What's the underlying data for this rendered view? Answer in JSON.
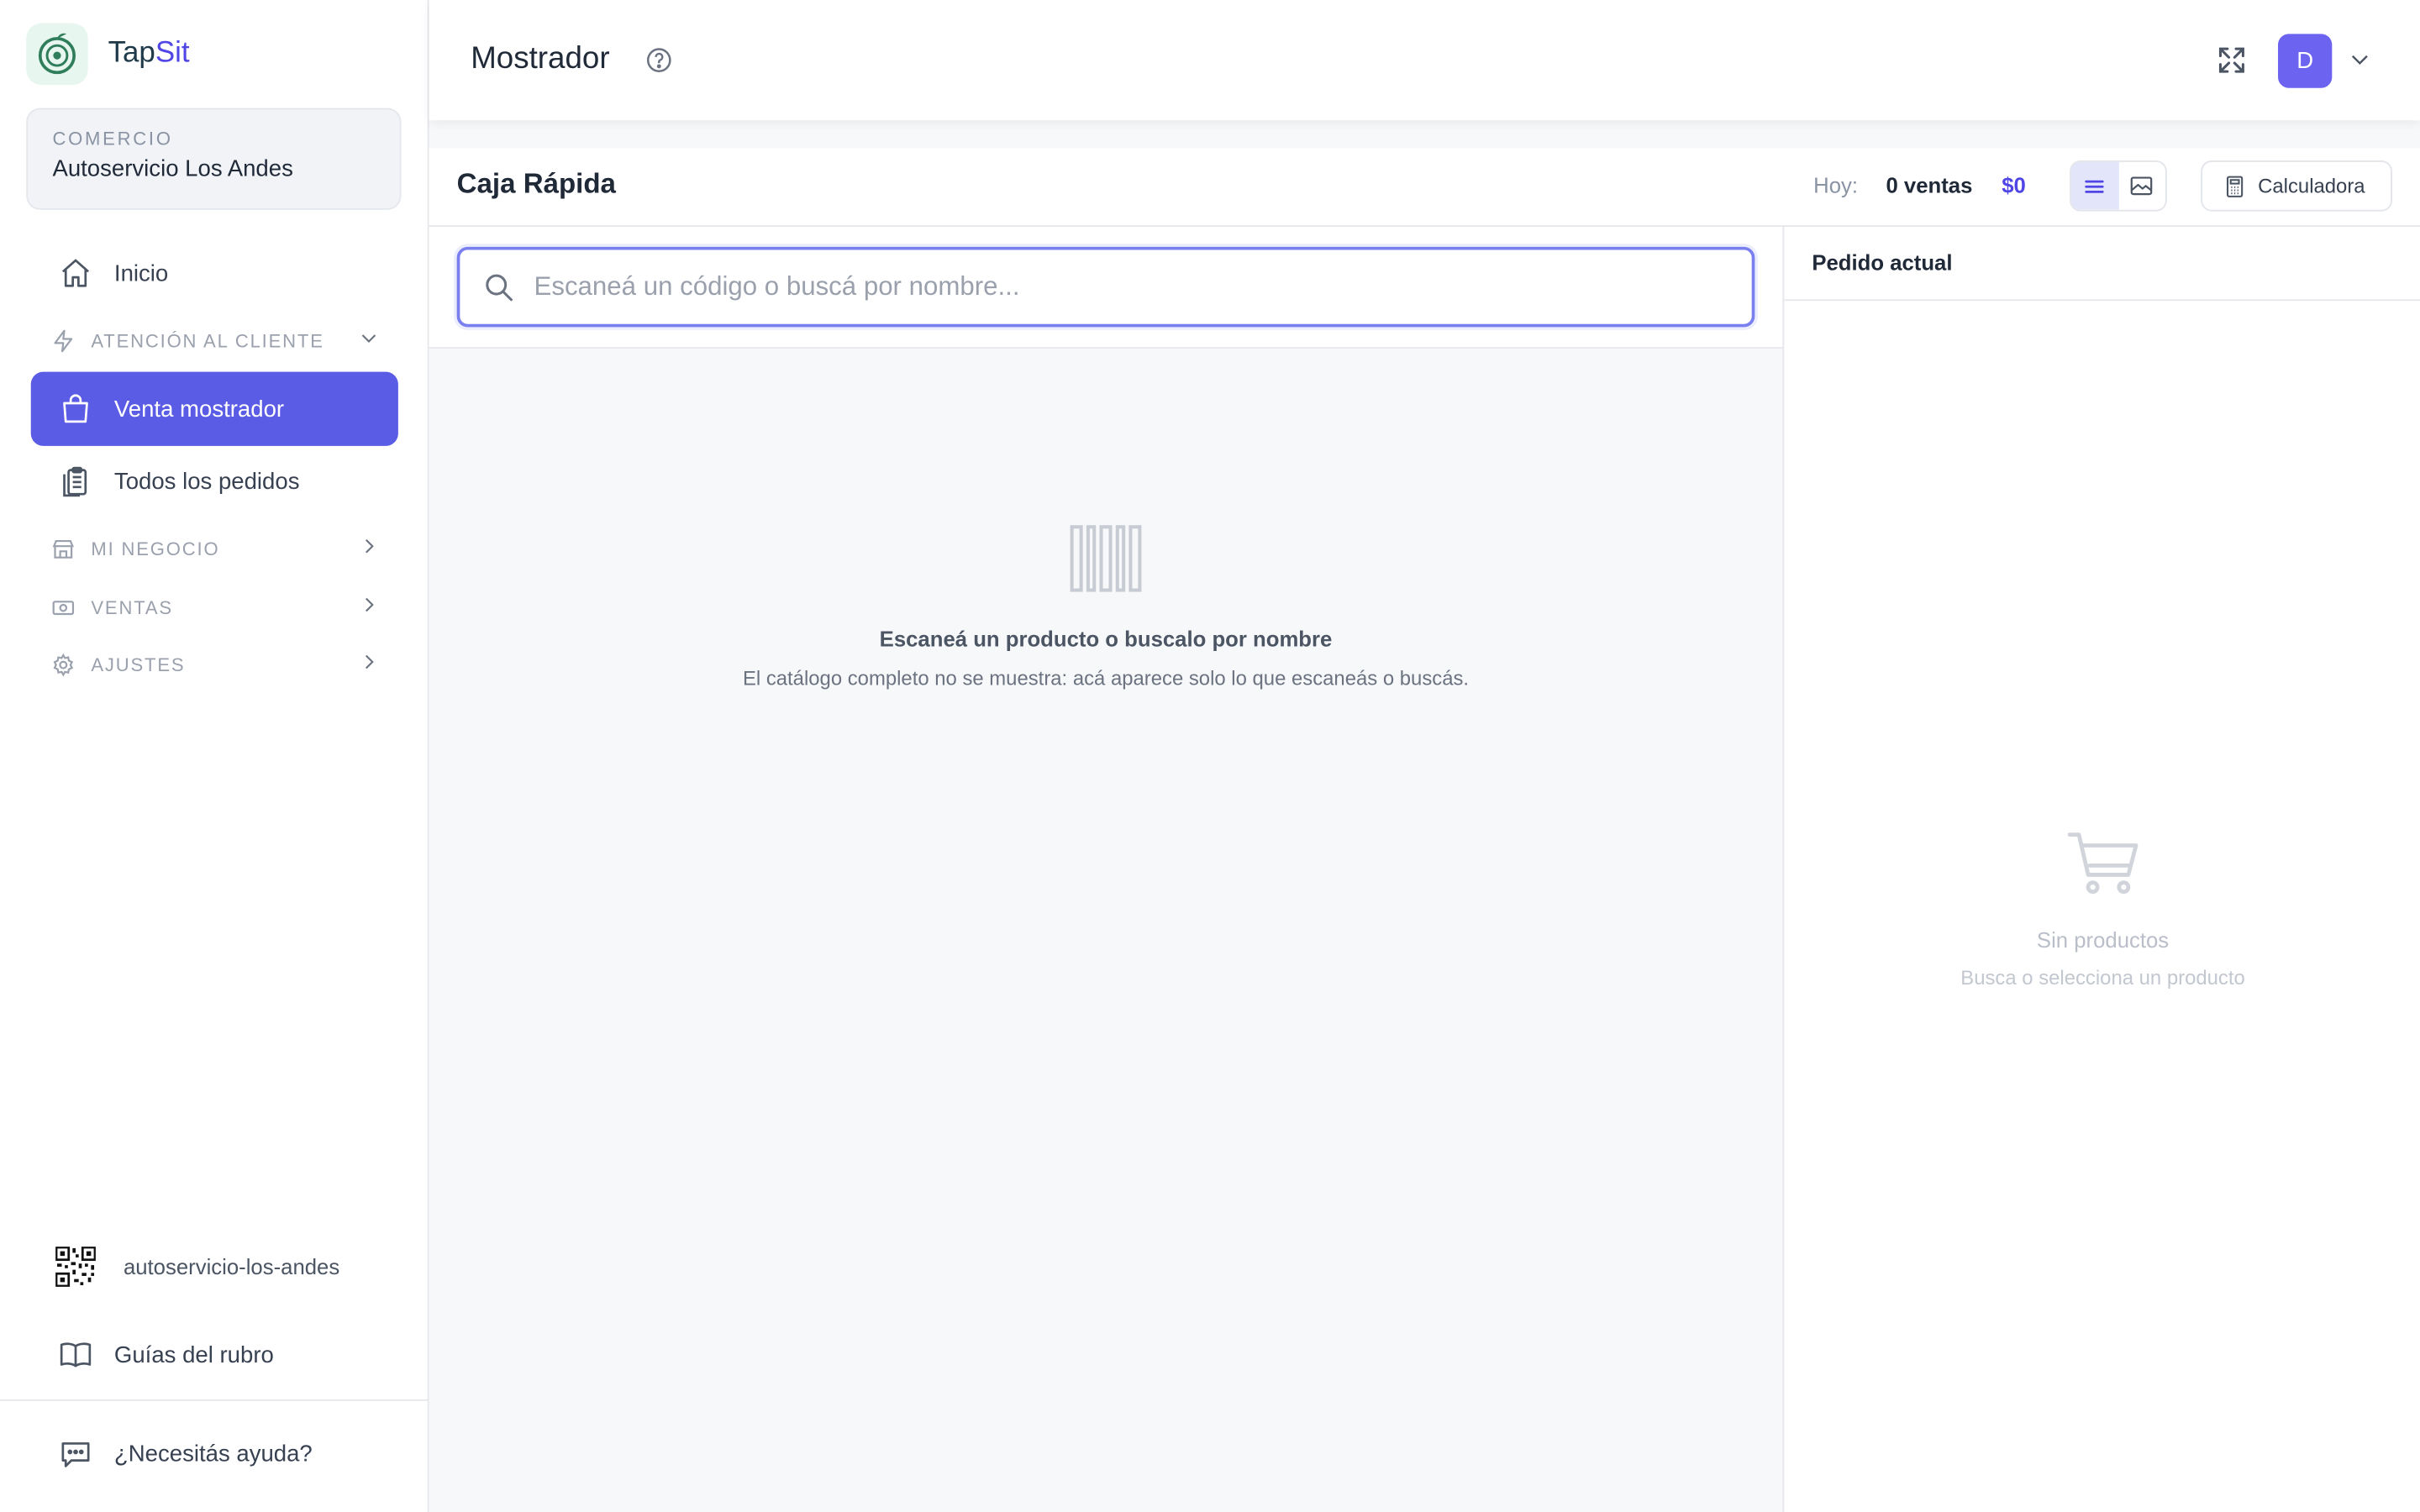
{
  "brand": {
    "name_part1": "Tap",
    "name_part2": "Sit",
    "logo_icon": "logo-icon",
    "accent_color": "#4f46e5"
  },
  "store": {
    "label": "COMERCIO",
    "name": "Autoservicio Los Andes"
  },
  "sidebar": {
    "items": [
      {
        "label": "Inicio",
        "icon": "home-icon"
      },
      {
        "label": "ATENCIÓN AL CLIENTE",
        "icon": "bolt-icon",
        "type": "section",
        "expanded": true
      },
      {
        "label": "Venta mostrador",
        "icon": "shopping-bag-icon",
        "active": true
      },
      {
        "label": "Todos los pedidos",
        "icon": "clipboard-icon"
      },
      {
        "label": "MI NEGOCIO",
        "icon": "store-icon",
        "type": "section"
      },
      {
        "label": "VENTAS",
        "icon": "cash-icon",
        "type": "section"
      },
      {
        "label": "AJUSTES",
        "icon": "gear-icon",
        "type": "section"
      }
    ],
    "slug": "autoservicio-los-andes",
    "guides": "Guías del rubro",
    "help": "¿Necesitás ayuda?",
    "active_color": "#5b5ce6"
  },
  "header": {
    "title": "Mostrador",
    "avatar_initial": "D"
  },
  "toolbar": {
    "title": "Caja Rápida",
    "today_label": "Hoy:",
    "sales_count": "0 ventas",
    "sales_total": "$0",
    "calculator_label": "Calculadora"
  },
  "search": {
    "placeholder": "Escaneá un código o buscá por nombre..."
  },
  "catalog_empty": {
    "title": "Escaneá un producto o buscalo por nombre",
    "subtitle": "El catálogo completo no se muestra: acá aparece solo lo que escaneás o buscás."
  },
  "order": {
    "title": "Pedido actual",
    "empty_title": "Sin productos",
    "empty_subtitle": "Busca o selecciona un producto"
  }
}
